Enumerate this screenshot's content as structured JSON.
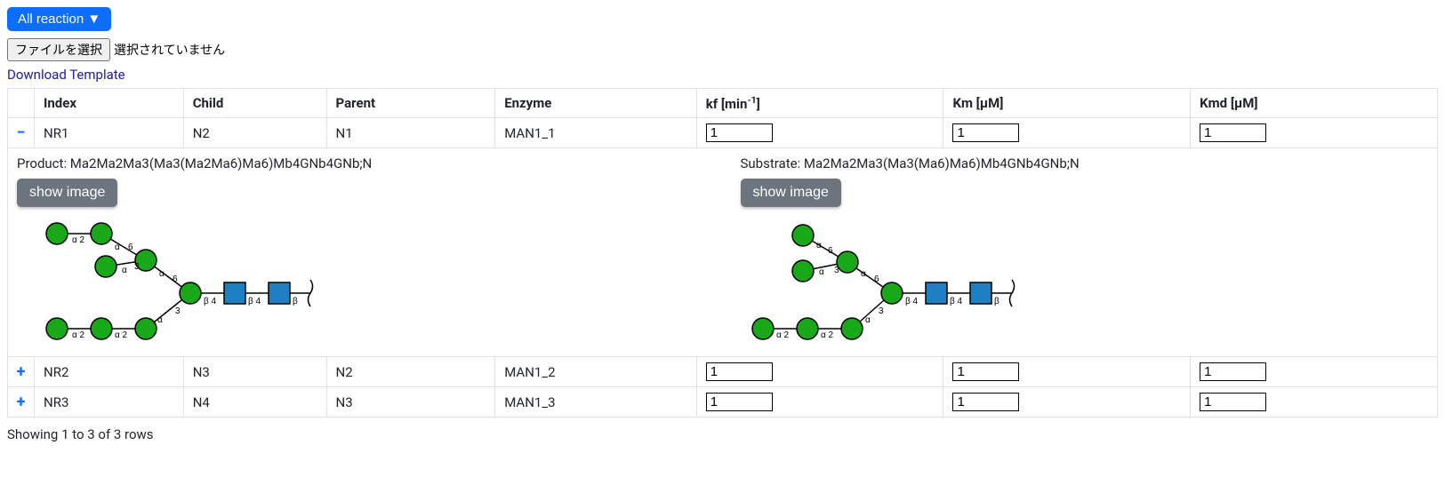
{
  "dropdown": {
    "label": "All reaction ▼"
  },
  "file": {
    "button": "ファイルを選択",
    "status": "選択されていません"
  },
  "download_link": "Download Template",
  "table": {
    "headers": {
      "index": "Index",
      "child": "Child",
      "parent": "Parent",
      "enzyme": "Enzyme",
      "kf_prefix": "kf [min",
      "kf_sup": "-1",
      "kf_suffix": "]",
      "km": "Km [µM]",
      "kmd": "Kmd [µM]"
    },
    "rows": [
      {
        "toggle": "−",
        "expanded": true,
        "index": "NR1",
        "child": "N2",
        "parent": "N1",
        "enzyme": "MAN1_1",
        "kf": "1",
        "km": "1",
        "kmd": "1"
      },
      {
        "toggle": "+",
        "expanded": false,
        "index": "NR2",
        "child": "N3",
        "parent": "N2",
        "enzyme": "MAN1_2",
        "kf": "1",
        "km": "1",
        "kmd": "1"
      },
      {
        "toggle": "+",
        "expanded": false,
        "index": "NR3",
        "child": "N4",
        "parent": "N3",
        "enzyme": "MAN1_3",
        "kf": "1",
        "km": "1",
        "kmd": "1"
      }
    ]
  },
  "detail": {
    "product_label": "Product: Ma2Ma2Ma3(Ma3(Ma2Ma6)Ma6)Mb4GNb4GNb;N",
    "substrate_label": "Substrate: Ma2Ma2Ma3(Ma3(Ma6)Ma6)Mb4GNb4GNb;N",
    "show_button": "show image"
  },
  "footer": "Showing 1 to 3 of 3 rows"
}
